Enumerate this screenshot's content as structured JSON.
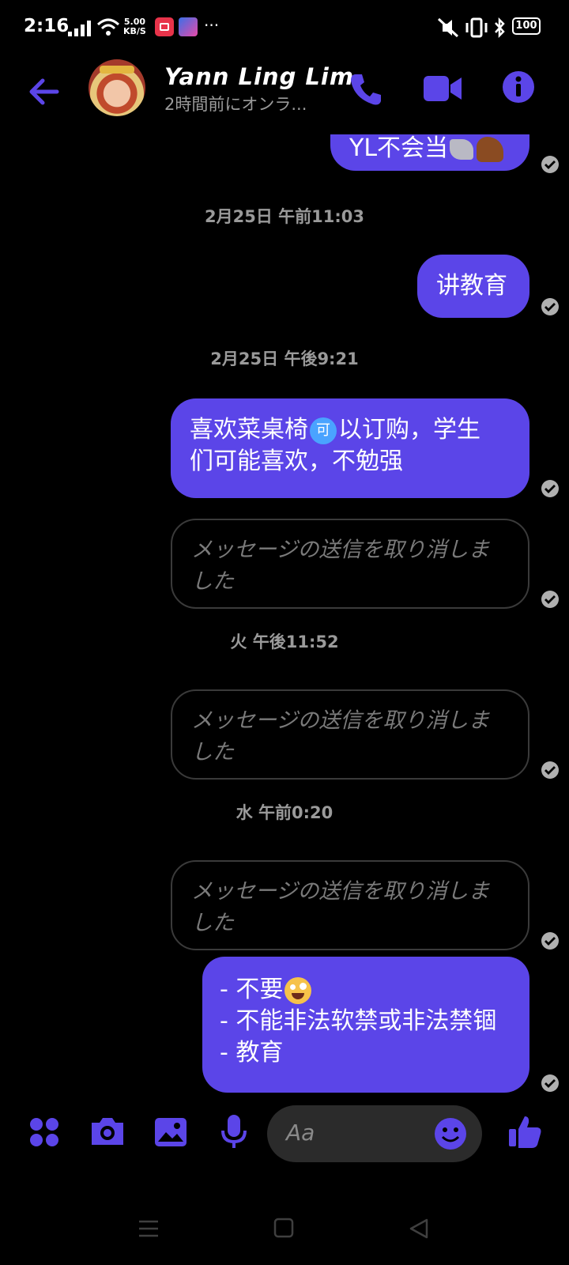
{
  "status_bar": {
    "time": "2:16",
    "net_speed_value": "5.00",
    "net_speed_unit": "KB/S",
    "battery": "100",
    "more": "···"
  },
  "header": {
    "contact_name": "Yann Ling Lim",
    "presence": "2時間前にオンラ..."
  },
  "messages": [
    {
      "type": "out",
      "text": "YL不会当"
    },
    {
      "type": "timestamp",
      "text": "2月25日 午前11:03"
    },
    {
      "type": "out",
      "text": "讲教育"
    },
    {
      "type": "timestamp",
      "text": "2月25日 午後9:21"
    },
    {
      "type": "out",
      "text_a": "喜欢菜桌椅",
      "chip": "可",
      "text_b": "以订购，学生",
      "text_c": "们可能喜欢，不勉强"
    },
    {
      "type": "unsent",
      "line1": "メッセージの送信を取り消しま",
      "line2": "した"
    },
    {
      "type": "timestamp",
      "text": "火 午後11:52"
    },
    {
      "type": "unsent",
      "line1": "メッセージの送信を取り消しま",
      "line2": "した"
    },
    {
      "type": "timestamp",
      "text": "水 午前0:20"
    },
    {
      "type": "unsent",
      "line1": "メッセージの送信を取り消しま",
      "line2": "した"
    },
    {
      "type": "out",
      "line1": "- 不要",
      "line2": "- 不能非法软禁或非法禁锢",
      "line3": "- 教育"
    }
  ],
  "composer": {
    "placeholder": "Aa"
  },
  "accent_color": "#5b45e8"
}
